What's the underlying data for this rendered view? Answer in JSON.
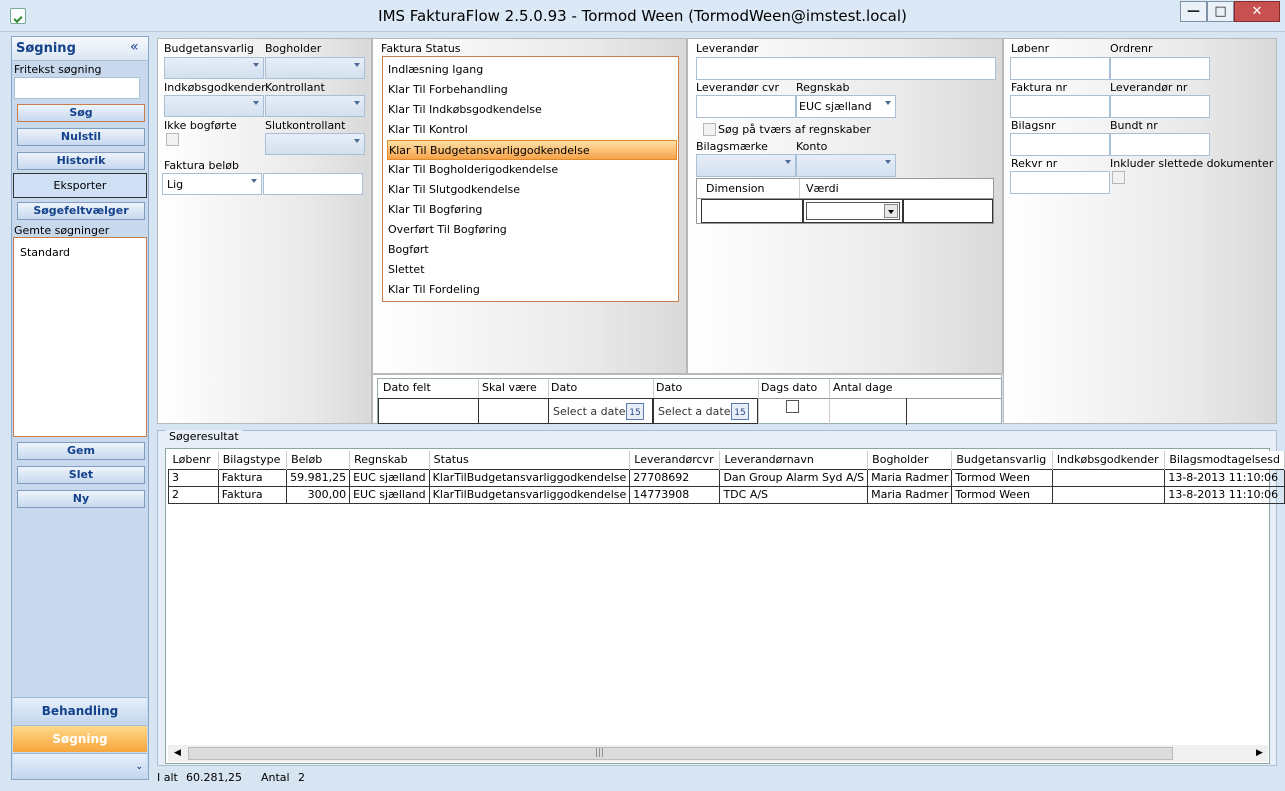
{
  "window": {
    "title": "IMS FakturaFlow 2.5.0.93 - Tormod Ween (TormodWeen@imstest.local)"
  },
  "left": {
    "title": "Søgning",
    "fritekst_label": "Fritekst søgning",
    "fritekst_value": "",
    "buttons": {
      "soeg": "Søg",
      "nulstil": "Nulstil",
      "historik": "Historik",
      "eksporter": "Eksporter",
      "soegefelt": "Søgefeltvælger"
    },
    "saved_label": "Gemte søgninger",
    "saved_items": [
      "Standard"
    ],
    "bottom_buttons": {
      "gem": "Gem",
      "slet": "Slet",
      "ny": "Ny"
    },
    "nav": {
      "behandling": "Behandling",
      "soegning": "Søgning"
    }
  },
  "filters1": {
    "budget": "Budgetansvarlig",
    "bogholder": "Bogholder",
    "indkob": "Indkøbsgodkender",
    "kontrollant": "Kontrollant",
    "ikke_bogforte": "Ikke bogførte",
    "slutkontrollant": "Slutkontrollant",
    "belob_label": "Faktura beløb",
    "belob_op": "Lig",
    "belob_value": ""
  },
  "status": {
    "label": "Faktura Status",
    "items": [
      "Indlæsning Igang",
      "Klar Til Forbehandling",
      "Klar Til Indkøbsgodkendelse",
      "Klar Til Kontrol",
      "Klar Til Budgetansvarliggodkendelse",
      "Klar Til Bogholderigodkendelse",
      "Klar Til Slutgodkendelse",
      "Klar Til Bogføring",
      "Overført Til Bogføring",
      "Bogført",
      "Slettet",
      "Klar Til Fordeling"
    ],
    "selected_index": 4
  },
  "date": {
    "headers": [
      "Dato felt",
      "Skal være",
      "Dato",
      "Dato",
      "Dags dato",
      "Antal dage"
    ],
    "placeholder": "Select a date",
    "cal_day": "15"
  },
  "supplier": {
    "leverandor": "Leverandør",
    "cvr": "Leverandør cvr",
    "regnskab": "Regnskab",
    "regnskab_value": "EUC sjælland",
    "tvaers": "Søg på tværs af regnskaber",
    "bilagsmaerke": "Bilagsmærke",
    "konto": "Konto",
    "dim_headers": [
      "Dimension",
      "Værdi"
    ]
  },
  "numbers": {
    "lobenr": "Løbenr",
    "ordrenr": "Ordrenr",
    "faktura_nr": "Faktura nr",
    "leverandor_nr": "Leverandør nr",
    "bilagsnr": "Bilagsnr",
    "bundt_nr": "Bundt nr",
    "rekvr_nr": "Rekvr nr",
    "inkluder": "Inkluder slettede dokumenter"
  },
  "results": {
    "title": "Søgeresultat",
    "columns": [
      "Løbenr",
      "Bilagstype",
      "Beløb",
      "Regnskab",
      "Status",
      "Leverandørcvr",
      "Leverandørnavn",
      "Bogholder",
      "Budgetansvarlig",
      "Indkøbsgodkender",
      "Bilagsmodtagelsesd"
    ],
    "rows": [
      [
        "3",
        "Faktura",
        "59.981,25",
        "EUC sjælland",
        "KlarTilBudgetansvarliggodkendelse",
        "27708692",
        "Dan Group Alarm Syd A/S",
        "Maria Radmer",
        "Tormod Ween",
        "",
        "13-8-2013 11:10:06"
      ],
      [
        "2",
        "Faktura",
        "300,00",
        "EUC sjælland",
        "KlarTilBudgetansvarliggodkendelse",
        "14773908",
        "TDC A/S",
        "Maria Radmer",
        "Tormod Ween",
        "",
        "13-8-2013 11:10:06"
      ]
    ]
  },
  "statusbar": {
    "ialt_label": "I alt",
    "ialt_value": "60.281,25",
    "antal_label": "Antal",
    "antal_value": "2"
  }
}
